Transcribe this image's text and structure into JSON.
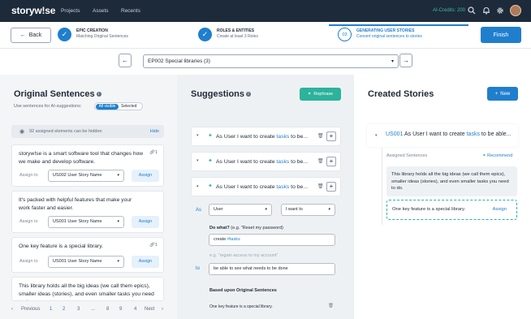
{
  "topbar": {
    "logo": "storyw!se",
    "nav": [
      "Projects",
      "Assets",
      "Recents"
    ],
    "credits": "AI-Credits: 200",
    "icons": [
      "search-icon",
      "bell-icon",
      "settings-icon"
    ]
  },
  "stepper": {
    "back": "Back",
    "steps": [
      {
        "title": "EPIC CREATION",
        "sub": "Matching Original Sentences",
        "num": "✓"
      },
      {
        "title": "ROLES & ENTITIES",
        "sub": "Create at least 3 Roles",
        "num": "✓"
      },
      {
        "title": "GENERATING USER STORIES",
        "sub": "Convert original sentences to stories",
        "num": "03"
      }
    ],
    "finish": "Finish"
  },
  "epic": {
    "selected": "EP002 Special libraries (3)"
  },
  "original": {
    "title": "Original Sentences",
    "use_label": "Use sentences for AI-suggestions:",
    "toggle_on": "All visible",
    "toggle_off": "Selected",
    "hide_text": "92 assigned elements can be hidden",
    "hide_link": "Hide",
    "assign_to": "Assign to",
    "assign_btn": "Assign",
    "cards": [
      {
        "text": "storyw!se is a smart software tool that changes how we make and develop software.",
        "link_count": "1",
        "story": "US002 User Story Name"
      },
      {
        "text": "It's packed with helpful features that make your work faster and easier.",
        "story": "US001 User Story Name"
      },
      {
        "text": "One key feature is a special library.",
        "link_count": "1",
        "story": "US001 User Story Name"
      },
      {
        "text": "This library holds all the big ideas (we call them epics), smaller ideas (stories), and even smaller tasks you need to do."
      }
    ],
    "pager": {
      "prev": "Previous",
      "pages": [
        "1",
        "2",
        "3",
        "...",
        "8",
        "9",
        "4"
      ],
      "next": "Next"
    }
  },
  "suggestions": {
    "title": "Suggestions",
    "rephrase": "Rephrase",
    "row_prefix": "As User I want to create ",
    "row_hl": "tasks",
    "row_suffix": " to be...",
    "editor": {
      "as": "As",
      "role": "User",
      "verb": "I want to",
      "what_label": "Do what?",
      "what_hint": "(e.g. \"Reset my password)",
      "what_value_prefix": "create ",
      "what_value_hl": "#tasks",
      "to_hint": "e.g. \"regain access to my account\"",
      "to": "to",
      "to_value": "be able to see what needs to be done",
      "based_label": "Based upon Original Sentences",
      "based_item": "One key feature is a special library."
    }
  },
  "created": {
    "title": "Created Stories",
    "new": "New",
    "story_id": "US001",
    "story_prefix": " As User I want to create ",
    "story_hl": "tasks",
    "story_suffix": " to be able...",
    "assigned_label": "Assigned Sentences",
    "recommend": "Recommend",
    "assigned": "This library holds all the big ideas (we call them epics), smaller ideas (stories), and even smaller tasks you need to do.",
    "suggest": "One key feature is a special library.",
    "assign": "Assign"
  }
}
